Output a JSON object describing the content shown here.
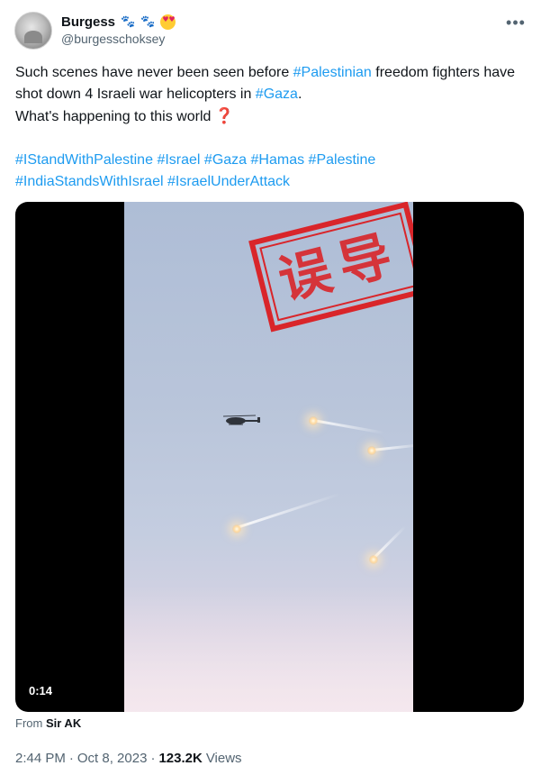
{
  "author": {
    "display_name": "Burgess",
    "handle": "@burgesschoksey",
    "badges": [
      "paw-prints-emoji",
      "paw-prints-emoji",
      "heart-eyes-emoji"
    ]
  },
  "more_icon": "more-icon",
  "tweet": {
    "line1_text": "Such scenes have never been seen before ",
    "line1_tag": "#Palestinian",
    "line1_rest": " freedom fighters have shot down 4 Israeli war helicopters in ",
    "line1_tag2": "#Gaza",
    "line1_end": ".",
    "line2_text": "What's happening to this world ",
    "line2_emoji": "❓",
    "hashtags_row1": [
      "#IStandWithPalestine",
      "#Israel",
      "#Gaza",
      "#Hamas",
      "#Palestine"
    ],
    "hashtags_row2": [
      "#IndiaStandsWithIsrael",
      "#IsraelUnderAttack"
    ]
  },
  "media": {
    "stamp_text": "误导",
    "timecode": "0:14",
    "flares": [
      {
        "name": "flare-1"
      },
      {
        "name": "flare-2"
      },
      {
        "name": "flare-3"
      },
      {
        "name": "flare-4"
      }
    ]
  },
  "attribution": {
    "prefix": "From ",
    "source": "Sir AK"
  },
  "meta": {
    "time": "2:44 PM",
    "separator": "·",
    "date": "Oct 8, 2023",
    "separator2": "·",
    "views_count": "123.2K",
    "views_label": "Views"
  },
  "colors": {
    "link": "#1d9bf0",
    "stamp": "#d9252a",
    "secondary_text": "#536471"
  }
}
